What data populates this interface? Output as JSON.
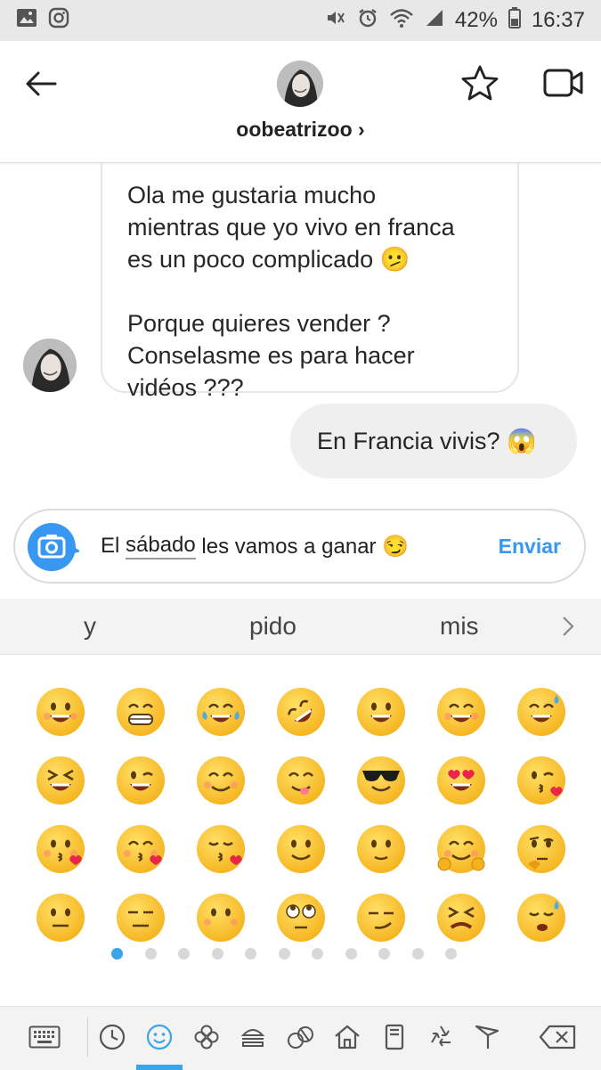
{
  "status_bar": {
    "battery": "42%",
    "time": "16:37"
  },
  "header": {
    "username": "oobeatrizoo",
    "chevron": "›"
  },
  "messages": {
    "incoming": [
      "Ola me gustaria mucho",
      "mientras que yo vivo en franca",
      "es un poco complicado 🫤",
      "",
      "Porque quieres vender ?",
      "Conselasme es para hacer",
      "vidéos ???"
    ],
    "outgoing": "En Francia vivis? 😱"
  },
  "composer": {
    "text_before": "El ",
    "text_underlined": "sábado",
    "text_after": " les vamos a ganar 😏",
    "send_label": "Enviar"
  },
  "keyboard": {
    "suggestions": [
      "y",
      "pido",
      "mis"
    ],
    "emoji_rows": [
      [
        "grinning",
        "grin",
        "joy",
        "rofl",
        "smiley",
        "smile",
        "sweat-smile"
      ],
      [
        "laughing",
        "wink",
        "blush",
        "yum",
        "sunglasses",
        "heart-eyes",
        "kissing-heart"
      ],
      [
        "kissing",
        "kissing-smiling",
        "kissing-closed",
        "slight-smile",
        "smiley-plain",
        "hugging",
        "thinking"
      ],
      [
        "neutral",
        "expressionless",
        "no-mouth",
        "rolling-eyes",
        "smirk",
        "persevere",
        "disappointed-relieved"
      ]
    ],
    "page_count": 12,
    "active_page": 1,
    "toolbar_icons": [
      "keyboard-icon",
      "clock-icon",
      "smiley-icon",
      "flower-icon",
      "food-icon",
      "ball-icon",
      "house-icon",
      "book-icon",
      "recycle-icon",
      "flag-icon",
      "backspace-icon"
    ],
    "accent": "#3aa5e8"
  },
  "colors": {
    "link": "#3897f0",
    "bubble_out": "#efefef"
  }
}
